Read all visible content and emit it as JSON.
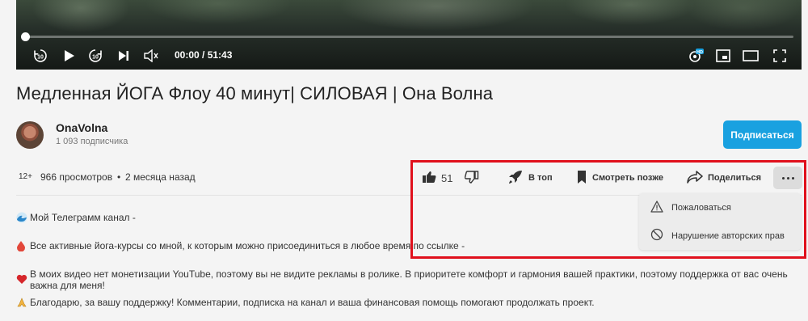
{
  "player": {
    "time": "00:00 / 51:43",
    "progress": 0,
    "icons": [
      "rewind-10-icon",
      "play-icon",
      "forward-10-icon",
      "next-icon",
      "volume-icon",
      "quality-hd-icon",
      "miniplayer-icon",
      "theater-icon",
      "fullscreen-icon"
    ]
  },
  "video": {
    "title": "Медленная ЙОГА Флоу 40 минут| СИЛОВАЯ | Она Волна"
  },
  "channel": {
    "name": "OnaVolna",
    "subscribers": "1 093 подписчика",
    "subscribe_label": "Подписаться"
  },
  "meta": {
    "age_rating": "12+",
    "views": "966 просмотров",
    "separator": "•",
    "published": "2 месяца назад"
  },
  "actions": {
    "like_count": "51",
    "top_label": "В топ",
    "watch_later_label": "Смотреть позже",
    "share_label": "Поделиться"
  },
  "menu": {
    "items": [
      {
        "label": "Пожаловаться",
        "icon": "warning-icon"
      },
      {
        "label": "Нарушение авторских прав",
        "icon": "block-icon"
      }
    ]
  },
  "description": {
    "lines": [
      "Мой Телеграмм канал -",
      "Все активные йога-курсы со мной, к которым можно присоединиться в любое время по ссылке -",
      "В моих видео нет монетизации YouTube, поэтому вы не видите рекламы в ролике. В приоритете комфорт и гармония вашей практики, поэтому поддержка от вас очень важна для меня!",
      "Благодарю, за вашу поддержку! Комментарии, подписка на канал и ваша финансовая помощь помогают продолжать проект."
    ]
  },
  "colors": {
    "subscribe": "#19a1e0",
    "highlight": "#e0101c"
  }
}
